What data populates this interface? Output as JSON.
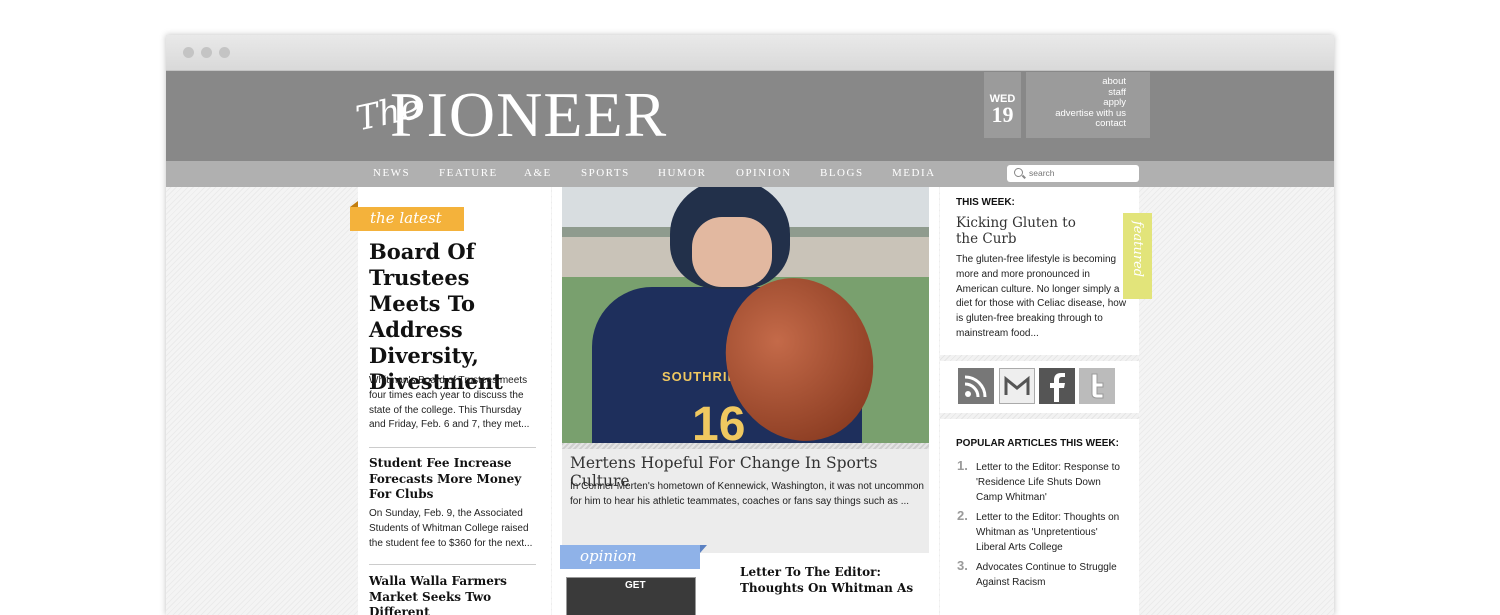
{
  "masthead": {
    "logo_script": "The",
    "logo_main": "PIONEER",
    "date_day": "WED",
    "date_num": "19",
    "links": [
      "about",
      "staff",
      "apply",
      "advertise with us",
      "contact"
    ]
  },
  "nav": {
    "items": [
      "NEWS",
      "FEATURE",
      "A&E",
      "SPORTS",
      "HUMOR",
      "OPINION",
      "BLOGS",
      "MEDIA"
    ],
    "search_placeholder": "search"
  },
  "latest": {
    "ribbon": "the latest",
    "lead_title": "Board Of Trustees Meets To Address Diversity, Divestment",
    "lead_text": "Whitman's Board of Trustees meets four times each year to discuss the state of the college. This Thursday and Friday, Feb. 6 and 7, they met...",
    "story2_title": "Student Fee Increase Forecasts More Money For Clubs",
    "story2_text": "On Sunday, Feb. 9, the Associated Students of Whitman College raised the student fee to $360 for the next...",
    "story3_title": "Walla Walla Farmers Market Seeks Two Different"
  },
  "feature_story": {
    "title": "Mertens Hopeful For Change In Sports Culture",
    "text": "In Conner Merten's hometown of Kennewick, Washington, it was not uncommon for him to hear his athletic teammates, coaches or fans say things such as ...",
    "jersey_text": "SOUTHRIDGE",
    "jersey_number": "16"
  },
  "opinion": {
    "ribbon": "opinion",
    "thumb_text": "GET",
    "title": "Letter To The Editor: Thoughts On Whitman As"
  },
  "sidebar": {
    "this_week_label": "THIS WEEK:",
    "this_week_title": "Kicking Gluten to the Curb",
    "this_week_text": "The gluten-free lifestyle is becoming more and more pronounced in American culture. No longer simply a diet for those with Celiac disease, how is gluten-free breaking through to mainstream food...",
    "featured_tag": "featured",
    "social_icons": [
      "rss-icon",
      "mail-icon",
      "facebook-icon",
      "twitter-icon"
    ],
    "popular_title": "POPULAR ARTICLES THIS WEEK:",
    "popular": [
      {
        "num": "1.",
        "text": "Letter to the Editor: Response to 'Residence Life Shuts Down Camp Whitman'"
      },
      {
        "num": "2.",
        "text": "Letter to the Editor: Thoughts on Whitman as 'Unpretentious' Liberal Arts College"
      },
      {
        "num": "3.",
        "text": "Advocates Continue to Struggle Against Racism"
      }
    ]
  },
  "colors": {
    "masthead": "#888888",
    "navbar": "#b0b0b0",
    "latest_ribbon": "#f4b23b",
    "opinion_ribbon": "#8fb2e8",
    "featured_tag": "#e2e47a"
  }
}
